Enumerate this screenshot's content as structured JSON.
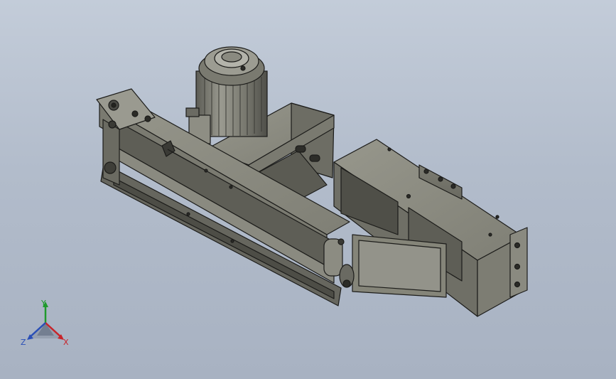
{
  "triad": {
    "x_label": "X",
    "y_label": "Y",
    "z_label": "Z",
    "x_color": "#c8242a",
    "y_color": "#1f9a2c",
    "z_color": "#2a4fb6"
  },
  "palette": {
    "background_top": "#c3ccd9",
    "background_bottom": "#a8b2c2",
    "part_light": "#8e8e83",
    "part_mid": "#77776d",
    "part_dark": "#5a5a52",
    "edge": "#1c1c1a"
  }
}
